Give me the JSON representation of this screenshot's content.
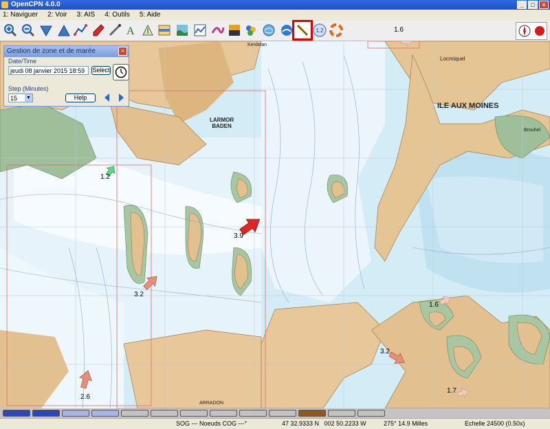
{
  "window": {
    "title": "OpenCPN 4.0.0",
    "minimize": "_",
    "maximize": "□",
    "close": "×"
  },
  "menu": [
    {
      "label": "1: Naviguer"
    },
    {
      "label": "2: Voir"
    },
    {
      "label": "3: AIS"
    },
    {
      "label": "4: Outils"
    },
    {
      "label": "5: Aide"
    }
  ],
  "toolbar": {
    "buttons": [
      "zoom-in-icon",
      "zoom-out-icon",
      "scale-down-icon",
      "scale-up-icon",
      "route-icon",
      "waypoint-icon",
      "measure-icon",
      "text-icon",
      "ais-icon",
      "chart-icon",
      "tide-icon",
      "graph-icon",
      "track-icon",
      "color-icon",
      "layers-icon",
      "globe-icon",
      "current-icon",
      "tide-level-icon",
      "lifebuoy-icon"
    ],
    "active": "current-icon",
    "tide_level_label": "1.2"
  },
  "chart": {
    "place_names": {
      "ile_aux_moines": "ILE AUX MOINES",
      "larmor_baden": "LARMOR\nBADEN",
      "locmiquel": "Locmiquel",
      "kerdelan": "Kerdelan",
      "arradon": "ARRADON",
      "brouhel": "Brouhel"
    },
    "currents": [
      {
        "id": "c1",
        "value": "1.2",
        "color": "#5dd68a"
      },
      {
        "id": "c2",
        "value": "3.9",
        "color": "#e0261f"
      },
      {
        "id": "c3",
        "value": "3.2",
        "color": "#e68f78"
      },
      {
        "id": "c4",
        "value": "2.6",
        "color": "#e68f78"
      },
      {
        "id": "c5",
        "value": "3.2",
        "color": "#e68f78"
      },
      {
        "id": "c6",
        "value": "1.6",
        "color": "#f2c9bd"
      },
      {
        "id": "c7",
        "value": "1.7",
        "color": "#f2c9bd"
      },
      {
        "id": "c8",
        "value": "1.6",
        "color": "#f2c9bd"
      }
    ]
  },
  "dialog": {
    "title": "Gestion de zone et de marée",
    "close": "×",
    "datetime_group": "Date/Time",
    "datetime_value": "jeudi 08 janvier 2015 18:59",
    "select_button": "Select",
    "step_group": "Step (Minutes)",
    "step_value": "15",
    "help_button": "Help"
  },
  "quilt": {
    "colors": [
      "#2d46b8",
      "#2d46b8",
      "#a8b4e6",
      "#a8b4e6",
      "#c2c2c2",
      "#c2c2c2",
      "#c2c2c2",
      "#c2c2c2",
      "#c2c2c2",
      "#c2c2c2",
      "#8f5a1e",
      "#c2c2c2",
      "#c2c2c2"
    ]
  },
  "status": {
    "sog_cog": "SOG --- Noeuds COG ---°",
    "position": "47 32.9333 N   002 50.2233 W",
    "bearing": "275°  14.9 Milles",
    "scale": "Echelle 24500 (0.50x)"
  }
}
